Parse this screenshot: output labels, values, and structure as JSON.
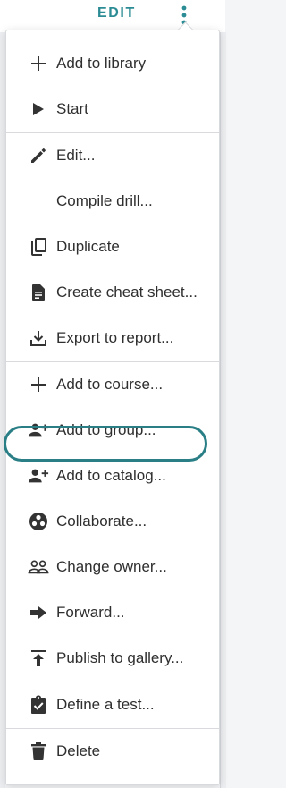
{
  "header": {
    "edit_label": "EDIT",
    "more_icon": "kebab-vertical-icon",
    "accent_color": "#2c8c95"
  },
  "menu": {
    "items": [
      {
        "id": "add-to-library",
        "label": "Add to library",
        "icon": "plus-icon"
      },
      {
        "id": "start",
        "label": "Start",
        "icon": "play-icon"
      },
      {
        "id": "edit",
        "label": "Edit...",
        "icon": "pencil-icon"
      },
      {
        "id": "compile-drill",
        "label": "Compile drill...",
        "icon": ""
      },
      {
        "id": "duplicate",
        "label": "Duplicate",
        "icon": "copy-icon"
      },
      {
        "id": "create-cheat-sheet",
        "label": "Create cheat sheet...",
        "icon": "document-icon"
      },
      {
        "id": "export-to-report",
        "label": "Export to report...",
        "icon": "download-tray-icon"
      },
      {
        "id": "add-to-course",
        "label": "Add to course...",
        "icon": "plus-icon"
      },
      {
        "id": "add-to-group",
        "label": "Add to group...",
        "icon": "person-add-icon"
      },
      {
        "id": "add-to-catalog",
        "label": "Add to catalog...",
        "icon": "person-add-icon"
      },
      {
        "id": "collaborate",
        "label": "Collaborate...",
        "icon": "group-circle-icon"
      },
      {
        "id": "change-owner",
        "label": "Change owner...",
        "icon": "people-outline-icon"
      },
      {
        "id": "forward",
        "label": "Forward...",
        "icon": "arrow-right-icon"
      },
      {
        "id": "publish-to-gallery",
        "label": "Publish to gallery...",
        "icon": "publish-icon"
      },
      {
        "id": "define-test",
        "label": "Define a test...",
        "icon": "clipboard-check-icon"
      },
      {
        "id": "delete",
        "label": "Delete",
        "icon": "trash-icon"
      }
    ],
    "highlighted_item": "add-to-catalog",
    "highlight_color": "#2a7f86"
  }
}
